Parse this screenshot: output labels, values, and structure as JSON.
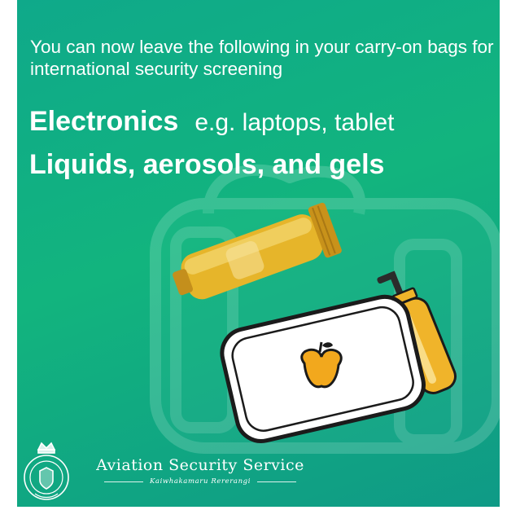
{
  "headline": "You can now leave the following in your carry-on bags for international security screening",
  "items": [
    {
      "title": "Electronics",
      "example": "e.g. laptops, tablet"
    },
    {
      "title": "Liquids, aerosols, and gels",
      "example": ""
    }
  ],
  "brand": {
    "name": "Aviation Security Service",
    "subtitle": "Kaiwhakamaru Rererangi",
    "logo_icon": "crest-icon"
  },
  "illustration": {
    "objects": [
      "carry-on-bag-icon",
      "tube-icon",
      "lunchbox-icon",
      "apple-icon",
      "pump-bottle-icon"
    ]
  },
  "colors": {
    "background_start": "#0fa98a",
    "background_end": "#0f9a86",
    "text": "#ffffff",
    "tube": "#e6b52a",
    "bottle": "#f0b42a",
    "lunchbox_fill": "#ffffff",
    "outline": "#1b1b1b"
  }
}
